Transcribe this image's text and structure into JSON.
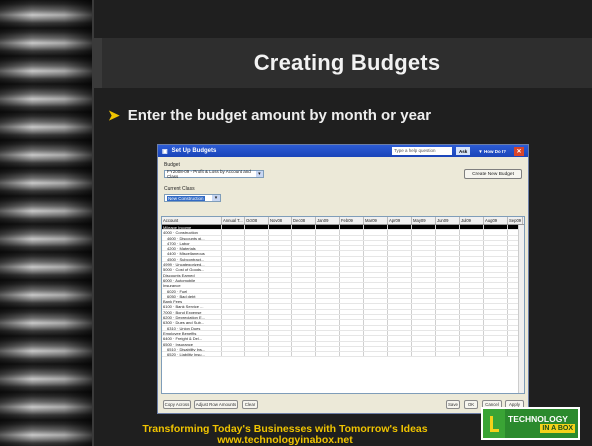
{
  "slide": {
    "title": "Creating Budgets",
    "bullet": "Enter the budget amount by month or year",
    "footer_line1": "Transforming Today's Businesses with Tomorrow's Ideas",
    "footer_line2": "www.technologyinabox.net",
    "logo_line1": "TECHNOLOGY",
    "logo_line2": "IN A BOX"
  },
  "app": {
    "window_title": "Set Up Budgets",
    "help_placeholder": "Type a help question",
    "ask_label": "Ask",
    "how_do_i_label": "How Do I?",
    "budget_label": "Budget",
    "budget_value": "FY2008-09 - Profit & Loss by Account and Class",
    "create_new_budget_label": "Create New Budget",
    "current_class_label": "Current Class",
    "current_class_value": "New Construction",
    "columns": [
      "Account",
      "Annual T...",
      "Oct08",
      "Nov08",
      "Dec08",
      "Jan09",
      "Feb09",
      "Mar09",
      "Apr09",
      "May09",
      "Jun09",
      "Jul09",
      "Aug09",
      "Sep09"
    ],
    "accounts": [
      "Mileage Income",
      "4000 · Construction",
      "4600 · Discounts gi...",
      "4700 · Labor",
      "4200 · Materials",
      "4400 · Miscellaneous",
      "4500 · Subcontract...",
      "4999 · Uncategorized...",
      "5000 · Cost of Goods...",
      "Discounts Earned",
      "6000 · Automobile",
      "Insurance",
      "6020 · Fuel",
      "6050 · Bad debt",
      "Bank Fees",
      "6100 · Bank Service ...",
      "7000 · Bond Expense",
      "6200 · Depreciation E...",
      "6300 · Dues and Sub...",
      "6310 · Union Dues",
      "Employee Benefits",
      "6400 · Freight & Del...",
      "6500 · Insurance",
      "6510 · Disability Ins...",
      "6520 · Liability Insu..."
    ],
    "bottom_buttons": [
      "Copy Across",
      "Adjust Row Amounts",
      "Clear"
    ],
    "save_label": "Save",
    "ok_label": "OK",
    "cancel_label": "Cancel",
    "apply_label": "Apply"
  },
  "colors": {
    "accent": "#f0c400",
    "background": "#1f1f1f",
    "title_band": "#2e2e2e",
    "logo_green": "#2b8a2d"
  }
}
